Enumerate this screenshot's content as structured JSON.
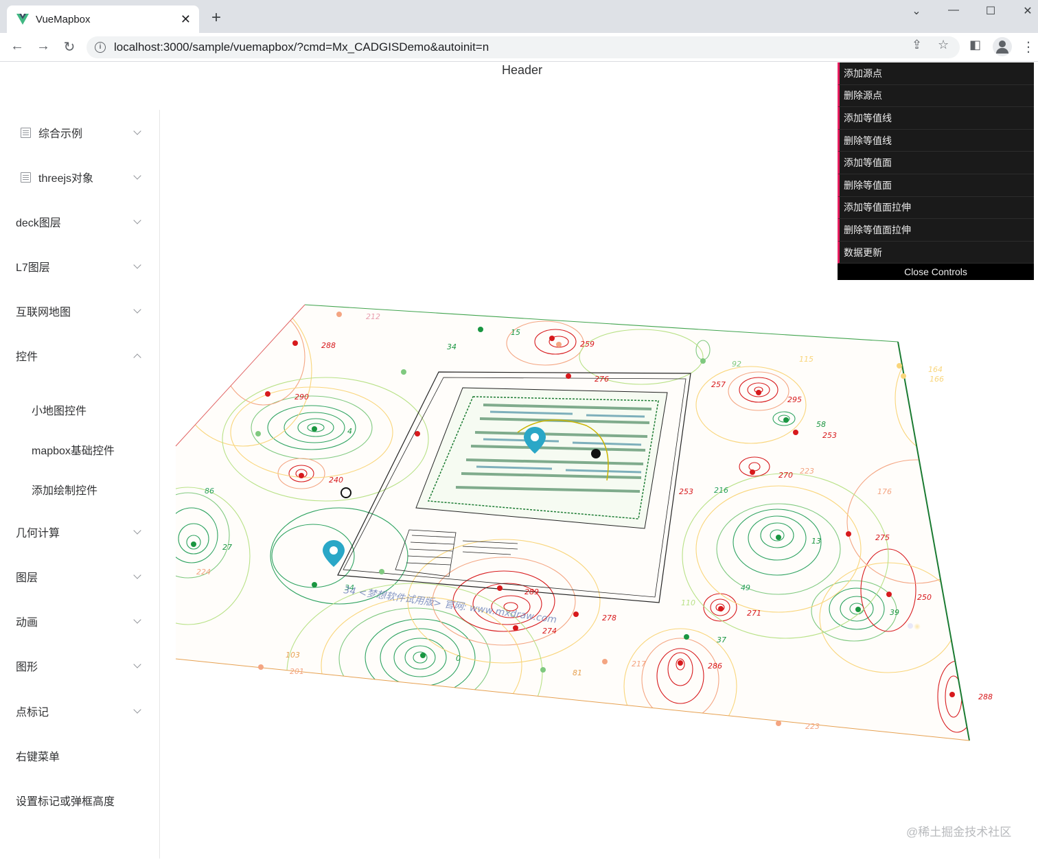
{
  "browser": {
    "tab_title": "VueMapbox",
    "url": "localhost:3000/sample/vuemapbox/?cmd=Mx_CADGISDemo&autoinit=n",
    "new_tab_icon": "plus-icon",
    "close_tab_icon": "close-icon",
    "colors": {
      "tabbar": "#dee1e6",
      "vue_green": "#41b883",
      "vue_dark": "#35495e"
    }
  },
  "header": {
    "title": "Header"
  },
  "sidebar": {
    "items": [
      {
        "label": "综合示例",
        "icon": "document-icon",
        "state": "collapsed"
      },
      {
        "label": "threejs对象",
        "icon": "document-icon",
        "state": "collapsed"
      },
      {
        "label": "deck图层",
        "state": "collapsed"
      },
      {
        "label": "L7图层",
        "state": "collapsed"
      },
      {
        "label": "互联网地图",
        "state": "collapsed"
      },
      {
        "label": "控件",
        "state": "expanded"
      },
      {
        "label": "小地图控件",
        "sub": true
      },
      {
        "label": "mapbox基础控件",
        "sub": true
      },
      {
        "label": "添加绘制控件",
        "sub": true
      },
      {
        "label": "几何计算",
        "state": "collapsed"
      },
      {
        "label": "图层",
        "state": "collapsed"
      },
      {
        "label": "动画",
        "state": "collapsed"
      },
      {
        "label": "图形",
        "state": "collapsed"
      },
      {
        "label": "点标记",
        "state": "collapsed"
      },
      {
        "label": "右键菜单"
      },
      {
        "label": "设置标记或弹框高度"
      }
    ]
  },
  "controls": {
    "buttons": [
      "添加源点",
      "删除源点",
      "添加等值线",
      "删除等值线",
      "添加等值面",
      "删除等值面",
      "添加等值面拉伸",
      "删除等值面拉伸",
      "数据更新"
    ],
    "close_label": "Close Controls",
    "accent": "#e61d5f"
  },
  "map": {
    "contour_labels": [
      "212",
      "288",
      "15",
      "34",
      "259",
      "276",
      "92",
      "115",
      "164",
      "166",
      "290",
      "257",
      "295",
      "4",
      "58",
      "253",
      "240",
      "270",
      "223",
      "86",
      "253",
      "216",
      "176",
      "27",
      "275",
      "224",
      "13",
      "34",
      "289",
      "49",
      "110",
      "271",
      "250",
      "39",
      "274",
      "278",
      "37",
      "103",
      "201",
      "0",
      "81",
      "217",
      "286",
      "288",
      "223"
    ],
    "cad_watermark": "34 <梦想软件试用版> 官网: www.mxdraw.com",
    "colors": {
      "low": "#1a9641",
      "mid": "#e8d27a",
      "high": "#d7191c",
      "marker": "#2aa7c7"
    }
  },
  "watermark": "@稀土掘金技术社区"
}
